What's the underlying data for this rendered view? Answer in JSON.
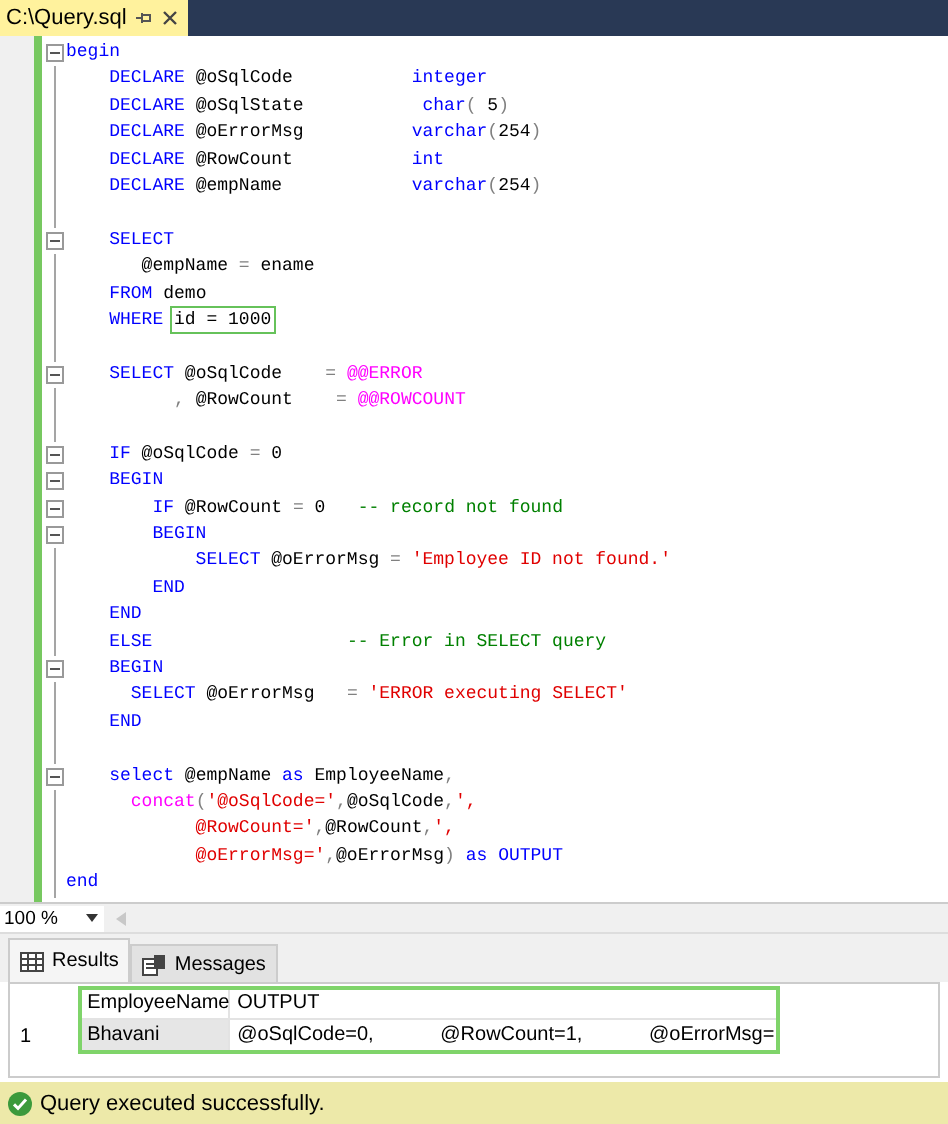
{
  "document_tab": {
    "title": "C:\\Query.sql",
    "selected": true
  },
  "code_lines": [
    {
      "fold": true,
      "tokens": [
        {
          "t": "begin",
          "kind": "kw"
        }
      ]
    },
    {
      "fold": false,
      "tokens": [
        {
          "t": "    DECLARE",
          "kind": "kw"
        },
        {
          "t": " @oSqlCode           ",
          "kind": "plain"
        },
        {
          "t": "integer",
          "kind": "kw"
        }
      ]
    },
    {
      "fold": false,
      "tokens": [
        {
          "t": "    DECLARE",
          "kind": "kw"
        },
        {
          "t": " @oSqlState           ",
          "kind": "plain"
        },
        {
          "t": "char",
          "kind": "kw"
        },
        {
          "t": "(",
          "kind": "op"
        },
        {
          "t": " 5",
          "kind": "plain"
        },
        {
          "t": ")",
          "kind": "op"
        }
      ]
    },
    {
      "fold": false,
      "tokens": [
        {
          "t": "    DECLARE",
          "kind": "kw"
        },
        {
          "t": " @oErrorMsg          ",
          "kind": "plain"
        },
        {
          "t": "varchar",
          "kind": "kw"
        },
        {
          "t": "(",
          "kind": "op"
        },
        {
          "t": "254",
          "kind": "plain"
        },
        {
          "t": ")",
          "kind": "op"
        }
      ]
    },
    {
      "fold": false,
      "tokens": [
        {
          "t": "    DECLARE",
          "kind": "kw"
        },
        {
          "t": " @RowCount           ",
          "kind": "plain"
        },
        {
          "t": "int",
          "kind": "kw"
        }
      ]
    },
    {
      "fold": false,
      "tokens": [
        {
          "t": "    DECLARE",
          "kind": "kw"
        },
        {
          "t": " @empName            ",
          "kind": "plain"
        },
        {
          "t": "varchar",
          "kind": "kw"
        },
        {
          "t": "(",
          "kind": "op"
        },
        {
          "t": "254",
          "kind": "plain"
        },
        {
          "t": ")",
          "kind": "op"
        }
      ]
    },
    {
      "fold": false
    },
    {
      "fold": true,
      "tokens": [
        {
          "t": "    SELECT",
          "kind": "kw"
        }
      ]
    },
    {
      "fold": false,
      "tokens": [
        {
          "t": "       @empName ",
          "kind": "plain"
        },
        {
          "t": "=",
          "kind": "op"
        },
        {
          "t": " ename",
          "kind": "plain"
        }
      ]
    },
    {
      "fold": false,
      "tokens": [
        {
          "t": "    FROM",
          "kind": "kw"
        },
        {
          "t": " demo",
          "kind": "plain"
        }
      ]
    },
    {
      "fold": false,
      "tokens": [
        {
          "t": "    WHERE ",
          "kind": "kw"
        },
        {
          "t": "id = 1000",
          "kind": "plain",
          "highlight": true
        }
      ]
    },
    {
      "fold": false
    },
    {
      "fold": true,
      "tokens": [
        {
          "t": "    SELECT",
          "kind": "kw"
        },
        {
          "t": " @oSqlCode    ",
          "kind": "plain"
        },
        {
          "t": "= ",
          "kind": "op"
        },
        {
          "t": "@@ERROR",
          "kind": "sys"
        }
      ]
    },
    {
      "fold": false,
      "tokens": [
        {
          "t": "          ,",
          "kind": "op"
        },
        {
          "t": " @RowCount    ",
          "kind": "plain"
        },
        {
          "t": "= ",
          "kind": "op"
        },
        {
          "t": "@@ROWCOUNT",
          "kind": "sys"
        }
      ]
    },
    {
      "fold": false
    },
    {
      "fold": true,
      "tokens": [
        {
          "t": "    IF",
          "kind": "kw"
        },
        {
          "t": " @oSqlCode ",
          "kind": "plain"
        },
        {
          "t": "=",
          "kind": "op"
        },
        {
          "t": " 0",
          "kind": "plain"
        }
      ]
    },
    {
      "fold": true,
      "tokens": [
        {
          "t": "    BEGIN",
          "kind": "kw"
        }
      ]
    },
    {
      "fold": true,
      "tokens": [
        {
          "t": "        IF",
          "kind": "kw"
        },
        {
          "t": " @RowCount ",
          "kind": "plain"
        },
        {
          "t": "=",
          "kind": "op"
        },
        {
          "t": " 0   ",
          "kind": "plain"
        },
        {
          "t": "-- record not found",
          "kind": "cmt"
        }
      ]
    },
    {
      "fold": true,
      "tokens": [
        {
          "t": "        BEGIN",
          "kind": "kw"
        }
      ]
    },
    {
      "fold": false,
      "tokens": [
        {
          "t": "            SELECT",
          "kind": "kw"
        },
        {
          "t": " @oErrorMsg ",
          "kind": "plain"
        },
        {
          "t": "= ",
          "kind": "op"
        },
        {
          "t": "'Employee ID not found.'",
          "kind": "str"
        }
      ]
    },
    {
      "fold": false,
      "tokens": [
        {
          "t": "        END",
          "kind": "kw"
        }
      ]
    },
    {
      "fold": false,
      "tokens": [
        {
          "t": "    END",
          "kind": "kw"
        }
      ]
    },
    {
      "fold": false,
      "tokens": [
        {
          "t": "    ELSE                  ",
          "kind": "kw"
        },
        {
          "t": "-- Error in SELECT query",
          "kind": "cmt"
        }
      ]
    },
    {
      "fold": true,
      "tokens": [
        {
          "t": "    BEGIN",
          "kind": "kw"
        }
      ]
    },
    {
      "fold": false,
      "tokens": [
        {
          "t": "      SELECT",
          "kind": "kw"
        },
        {
          "t": " @oErrorMsg   ",
          "kind": "plain"
        },
        {
          "t": "= ",
          "kind": "op"
        },
        {
          "t": "'ERROR executing SELECT'",
          "kind": "str"
        }
      ]
    },
    {
      "fold": false,
      "tokens": [
        {
          "t": "    END",
          "kind": "kw"
        }
      ]
    },
    {
      "fold": false
    },
    {
      "fold": true,
      "tokens": [
        {
          "t": "    select",
          "kind": "kw"
        },
        {
          "t": " @empName ",
          "kind": "plain"
        },
        {
          "t": "as",
          "kind": "kw"
        },
        {
          "t": " EmployeeName",
          "kind": "plain"
        },
        {
          "t": ",",
          "kind": "op"
        }
      ]
    },
    {
      "fold": false,
      "tokens": [
        {
          "t": "      concat",
          "kind": "fn"
        },
        {
          "t": "(",
          "kind": "op"
        },
        {
          "t": "'@oSqlCode='",
          "kind": "str"
        },
        {
          "t": ",",
          "kind": "op"
        },
        {
          "t": "@oSqlCode",
          "kind": "plain"
        },
        {
          "t": ",",
          "kind": "op"
        },
        {
          "t": "',",
          "kind": "str"
        }
      ]
    },
    {
      "fold": false,
      "tokens": [
        {
          "t": "            @RowCount='",
          "kind": "str"
        },
        {
          "t": ",",
          "kind": "op"
        },
        {
          "t": "@RowCount",
          "kind": "plain"
        },
        {
          "t": ",",
          "kind": "op"
        },
        {
          "t": "',",
          "kind": "str"
        }
      ]
    },
    {
      "fold": false,
      "tokens": [
        {
          "t": "            @oErrorMsg='",
          "kind": "str"
        },
        {
          "t": ",",
          "kind": "op"
        },
        {
          "t": "@oErrorMsg",
          "kind": "plain"
        },
        {
          "t": ") ",
          "kind": "op"
        },
        {
          "t": "as",
          "kind": "kw"
        },
        {
          "t": " OUTPUT",
          "kind": "kw"
        }
      ]
    },
    {
      "fold": false,
      "tokens": [
        {
          "t": "end",
          "kind": "kw"
        }
      ]
    }
  ],
  "zoom": {
    "value": "100 %"
  },
  "result_tabs": [
    {
      "label": "Results",
      "selected": true
    },
    {
      "label": "Messages",
      "selected": false
    }
  ],
  "grid": {
    "columns": [
      "EmployeeName",
      "OUTPUT"
    ],
    "rows": [
      {
        "number": "1",
        "cells": [
          "Bhavani",
          "@oSqlCode=0,            @RowCount=1,            @oErrorMsg="
        ]
      }
    ]
  },
  "status_bar": {
    "text": "Query executed successfully."
  }
}
